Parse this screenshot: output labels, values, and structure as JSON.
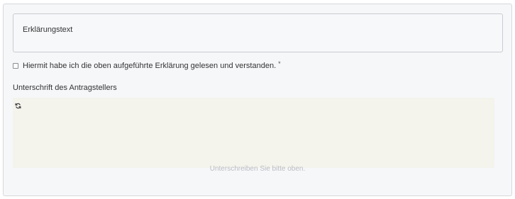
{
  "explanation": {
    "text": "Erklärungstext"
  },
  "consent": {
    "label": "Hiermit habe ich die oben aufgeführte Erklärung gelesen und verstanden.",
    "required_mark": "*",
    "checked": false
  },
  "signature": {
    "label": "Unterschrift des Antragstellers",
    "hint": "Unterschreiben Sie bitte oben.",
    "reset_icon": "refresh-icon",
    "pad_color": "#f4f3ec"
  }
}
